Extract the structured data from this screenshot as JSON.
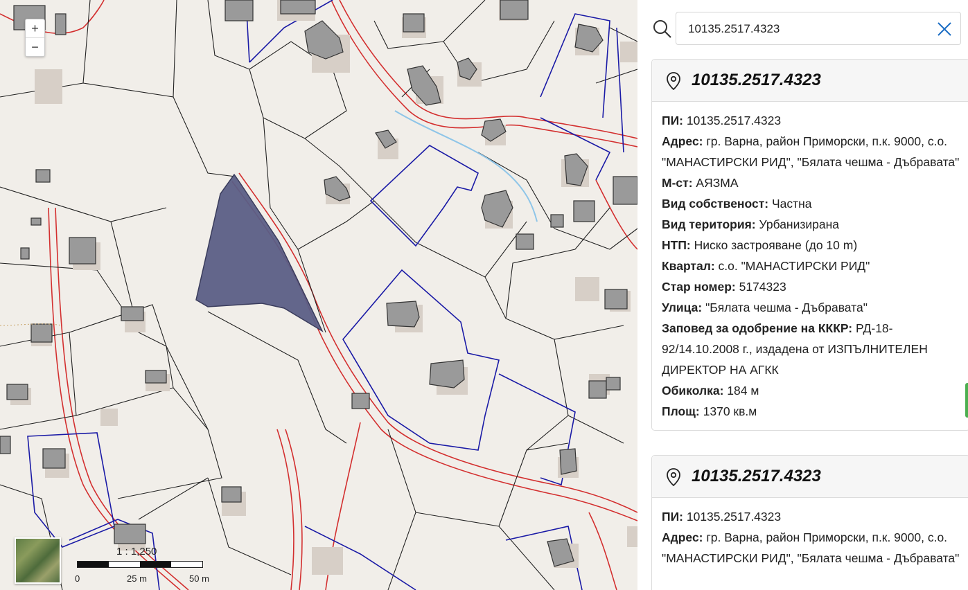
{
  "map": {
    "zoom_in": "+",
    "zoom_out": "−",
    "scale_ratio": "1 : 1,250",
    "scale_ticks": [
      "0",
      "25 m",
      "50 m"
    ],
    "colors": {
      "cadastre_red": "#d32f2f",
      "parcel_blue": "#1a1aa6",
      "selected_fill": "#5b5e86",
      "building": "#9a9a9a"
    }
  },
  "search": {
    "value": "10135.2517.4323",
    "placeholder": "",
    "icon": "search-icon",
    "clear_icon": "close-icon"
  },
  "cards": [
    {
      "title": "10135.2517.4323",
      "fields": [
        {
          "label": "ПИ:",
          "value": "10135.2517.4323"
        },
        {
          "label": "Адрес:",
          "value": "гр. Варна, район Приморски, п.к. 9000, с.о. \"МАНАСТИРСКИ РИД\", \"Бялата чешма - Дъбравата\""
        },
        {
          "label": "М-ст:",
          "value": "АЯЗМА"
        },
        {
          "label": "Вид собственост:",
          "value": "Частна"
        },
        {
          "label": "Вид територия:",
          "value": "Урбанизирана"
        },
        {
          "label": "НТП:",
          "value": "Ниско застрояване (до 10 m)"
        },
        {
          "label": "Квартал:",
          "value": "с.о. \"МАНАСТИРСКИ РИД\""
        },
        {
          "label": "Стар номер:",
          "value": "5174323"
        },
        {
          "label": "Улица:",
          "value": "\"Бялата чешма - Дъбравата\""
        },
        {
          "label": "Заповед за одобрение на КККР:",
          "value": "РД-18-92/14.10.2008 г., издадена от ИЗПЪЛНИТЕЛЕН ДИРЕКТОР НА АГКК"
        },
        {
          "label": "Обиколка:",
          "value": "184 м"
        },
        {
          "label": "Площ:",
          "value": "1370 кв.м"
        }
      ]
    },
    {
      "title": "10135.2517.4323",
      "fields": [
        {
          "label": "ПИ:",
          "value": "10135.2517.4323"
        },
        {
          "label": "Адрес:",
          "value": "гр. Варна, район Приморски, п.к. 9000, с.о. \"МАНАСТИРСКИ РИД\", \"Бялата чешма - Дъбравата\""
        }
      ]
    }
  ]
}
